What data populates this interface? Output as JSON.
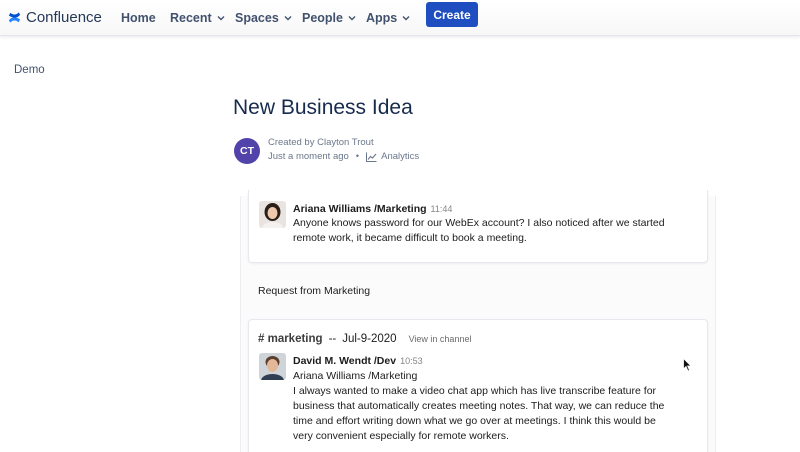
{
  "app": {
    "name": "Confluence"
  },
  "nav": {
    "home": "Home",
    "recent": "Recent",
    "spaces": "Spaces",
    "people": "People",
    "apps": "Apps",
    "create": "Create"
  },
  "space": {
    "name": "Demo"
  },
  "page": {
    "title": "New Business Idea",
    "avatar_initials": "CT",
    "created_by": "Created by Clayton Trout",
    "updated": "Just a moment ago",
    "separator": "•",
    "analytics": "Analytics"
  },
  "message1": {
    "author": "Ariana Williams /Marketing",
    "time": "11:44",
    "text_line1": "Anyone knows password for our WebEx account? I also noticed after we started",
    "text_line2": "remote work, it became difficult to book a meeting."
  },
  "request_label": "Request from Marketing",
  "channel": {
    "name": "# marketing",
    "separator": "--",
    "date": "Jul-9-2020",
    "view_link": "View in channel"
  },
  "message2": {
    "author": "David M. Wendt /Dev",
    "time": "10:53",
    "mention": "Ariana Williams /Marketing",
    "text_line1": "I always wanted to make a video chat app which has live transcribe feature for",
    "text_line2": "business that automatically creates meeting notes. That way, we can reduce the",
    "text_line3": "time and effort writing down what we go over at meetings. I think this would be",
    "text_line4": "very convenient especially for remote workers."
  },
  "colors": {
    "brand": "#1f4ec0",
    "avatar": "#5243aa",
    "text": "#172b4d"
  }
}
